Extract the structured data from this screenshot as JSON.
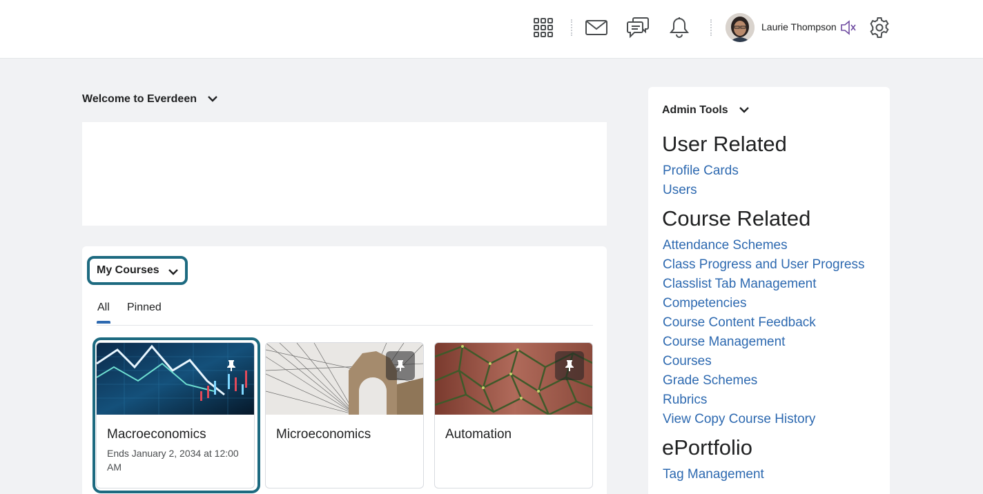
{
  "header": {
    "user_name": "Laurie Thompson",
    "icons": [
      "grid-apps-icon",
      "mail-icon",
      "chat-icon",
      "bell-icon",
      "speaker-icon",
      "gear-icon"
    ]
  },
  "welcome": {
    "title": "Welcome to Everdeen"
  },
  "my_courses": {
    "title": "My Courses",
    "tabs": [
      {
        "label": "All",
        "selected": true
      },
      {
        "label": "Pinned",
        "selected": false
      }
    ],
    "cards": [
      {
        "name": "Macroeconomics",
        "sub": "Ends January 2, 2034 at 12:00 AM",
        "pinned": true,
        "focused": true
      },
      {
        "name": "Microeconomics",
        "sub": "",
        "pinned": true,
        "focused": false
      },
      {
        "name": "Automation",
        "sub": "",
        "pinned": true,
        "focused": false
      }
    ]
  },
  "admin_tools": {
    "title": "Admin Tools",
    "sections": [
      {
        "heading": "User Related",
        "links": [
          "Profile Cards",
          "Users"
        ]
      },
      {
        "heading": "Course Related",
        "links": [
          "Attendance Schemes",
          "Class Progress and User Progress",
          "Classlist Tab Management",
          "Competencies",
          "Course Content Feedback",
          "Course Management",
          "Courses",
          "Grade Schemes",
          "Rubrics",
          "View Copy Course History"
        ]
      },
      {
        "heading": "ePortfolio",
        "links": [
          "Tag Management"
        ]
      }
    ]
  },
  "colors": {
    "link": "#2d69b0",
    "focus_ring": "#1d6a80",
    "page_bg": "#f1f2f4"
  }
}
